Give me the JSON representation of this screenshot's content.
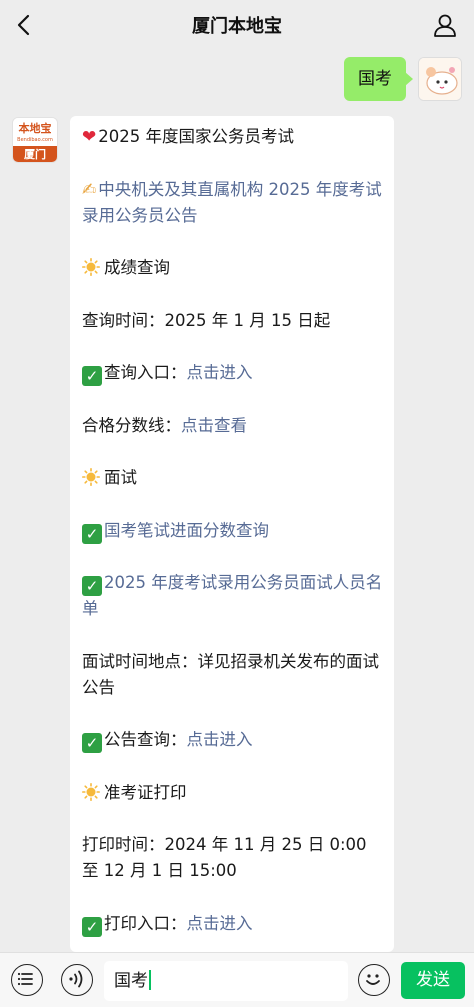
{
  "header": {
    "title": "厦门本地宝"
  },
  "user_message": {
    "text": "国考"
  },
  "bot": {
    "avatar": {
      "logo_text": "本地宝",
      "logo_subtext": "Bendibao.com",
      "city": "厦门"
    },
    "lines": {
      "exam_title": "2025 年度国家公务员考试",
      "announcement_link": "中央机关及其直属机构 2025 年度考试录用公务员公告",
      "score_heading": "成绩查询",
      "score_time": "查询时间：2025 年 1 月 15 日起",
      "score_entry_label": "查询入口：",
      "score_entry_link": "点击进入",
      "pass_line_label": "合格分数线：",
      "pass_line_link": "点击查看",
      "interview_heading": "面试",
      "interview_score_link": "国考笔试进面分数查询",
      "interview_list_link": "2025 年度考试录用公务员面试人员名单",
      "interview_place": "面试时间地点：详见招录机关发布的面试公告",
      "notice_label": "公告查询：",
      "notice_link": "点击进入",
      "ticket_heading": "准考证打印",
      "print_time": "打印时间：2024 年 11 月 25 日 0:00 至 12 月 1 日 15:00",
      "print_entry_label": "打印入口：",
      "print_entry_link": "点击进入"
    }
  },
  "input_bar": {
    "value": "国考",
    "send_label": "发送"
  },
  "colors": {
    "accent_green": "#07c160",
    "bubble_green": "#95ec69",
    "link_blue": "#576b95",
    "brand_orange": "#d4541d"
  },
  "icons": [
    "back-arrow-icon",
    "user-profile-icon",
    "heart-icon",
    "writing-hand-icon",
    "sun-icon",
    "check-mark-icon",
    "menu-list-icon",
    "voice-icon",
    "emoji-icon"
  ]
}
